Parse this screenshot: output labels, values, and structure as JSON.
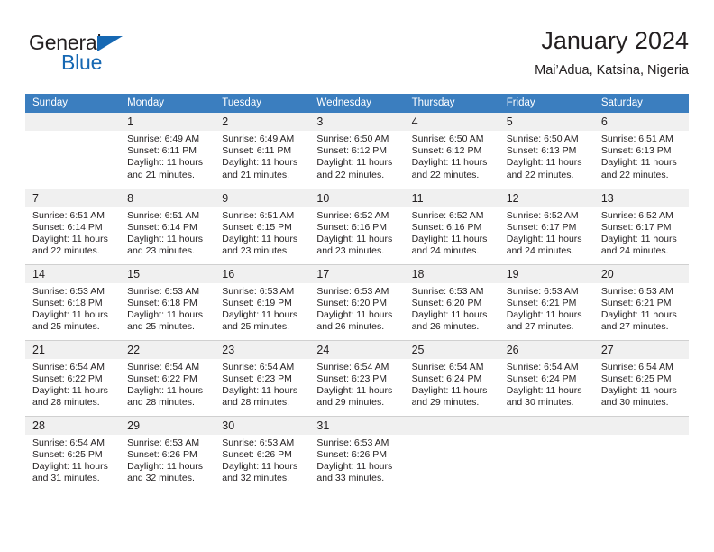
{
  "brand": {
    "word1": "General",
    "word2": "Blue",
    "triangle_color": "#1668b3"
  },
  "header": {
    "title": "January 2024",
    "subtitle": "Mai’Adua, Katsina, Nigeria"
  },
  "theme": {
    "header_bg": "#3b7ebf",
    "daynum_bg": "#f0f0f0",
    "grid_line": "#d0d0d0",
    "text": "#231f20"
  },
  "weekday_headers": [
    "Sunday",
    "Monday",
    "Tuesday",
    "Wednesday",
    "Thursday",
    "Friday",
    "Saturday"
  ],
  "weeks": [
    [
      {
        "day": "",
        "sunrise": "",
        "sunset": "",
        "daylight1": "",
        "daylight2": ""
      },
      {
        "day": "1",
        "sunrise": "Sunrise: 6:49 AM",
        "sunset": "Sunset: 6:11 PM",
        "daylight1": "Daylight: 11 hours",
        "daylight2": "and 21 minutes."
      },
      {
        "day": "2",
        "sunrise": "Sunrise: 6:49 AM",
        "sunset": "Sunset: 6:11 PM",
        "daylight1": "Daylight: 11 hours",
        "daylight2": "and 21 minutes."
      },
      {
        "day": "3",
        "sunrise": "Sunrise: 6:50 AM",
        "sunset": "Sunset: 6:12 PM",
        "daylight1": "Daylight: 11 hours",
        "daylight2": "and 22 minutes."
      },
      {
        "day": "4",
        "sunrise": "Sunrise: 6:50 AM",
        "sunset": "Sunset: 6:12 PM",
        "daylight1": "Daylight: 11 hours",
        "daylight2": "and 22 minutes."
      },
      {
        "day": "5",
        "sunrise": "Sunrise: 6:50 AM",
        "sunset": "Sunset: 6:13 PM",
        "daylight1": "Daylight: 11 hours",
        "daylight2": "and 22 minutes."
      },
      {
        "day": "6",
        "sunrise": "Sunrise: 6:51 AM",
        "sunset": "Sunset: 6:13 PM",
        "daylight1": "Daylight: 11 hours",
        "daylight2": "and 22 minutes."
      }
    ],
    [
      {
        "day": "7",
        "sunrise": "Sunrise: 6:51 AM",
        "sunset": "Sunset: 6:14 PM",
        "daylight1": "Daylight: 11 hours",
        "daylight2": "and 22 minutes."
      },
      {
        "day": "8",
        "sunrise": "Sunrise: 6:51 AM",
        "sunset": "Sunset: 6:14 PM",
        "daylight1": "Daylight: 11 hours",
        "daylight2": "and 23 minutes."
      },
      {
        "day": "9",
        "sunrise": "Sunrise: 6:51 AM",
        "sunset": "Sunset: 6:15 PM",
        "daylight1": "Daylight: 11 hours",
        "daylight2": "and 23 minutes."
      },
      {
        "day": "10",
        "sunrise": "Sunrise: 6:52 AM",
        "sunset": "Sunset: 6:16 PM",
        "daylight1": "Daylight: 11 hours",
        "daylight2": "and 23 minutes."
      },
      {
        "day": "11",
        "sunrise": "Sunrise: 6:52 AM",
        "sunset": "Sunset: 6:16 PM",
        "daylight1": "Daylight: 11 hours",
        "daylight2": "and 24 minutes."
      },
      {
        "day": "12",
        "sunrise": "Sunrise: 6:52 AM",
        "sunset": "Sunset: 6:17 PM",
        "daylight1": "Daylight: 11 hours",
        "daylight2": "and 24 minutes."
      },
      {
        "day": "13",
        "sunrise": "Sunrise: 6:52 AM",
        "sunset": "Sunset: 6:17 PM",
        "daylight1": "Daylight: 11 hours",
        "daylight2": "and 24 minutes."
      }
    ],
    [
      {
        "day": "14",
        "sunrise": "Sunrise: 6:53 AM",
        "sunset": "Sunset: 6:18 PM",
        "daylight1": "Daylight: 11 hours",
        "daylight2": "and 25 minutes."
      },
      {
        "day": "15",
        "sunrise": "Sunrise: 6:53 AM",
        "sunset": "Sunset: 6:18 PM",
        "daylight1": "Daylight: 11 hours",
        "daylight2": "and 25 minutes."
      },
      {
        "day": "16",
        "sunrise": "Sunrise: 6:53 AM",
        "sunset": "Sunset: 6:19 PM",
        "daylight1": "Daylight: 11 hours",
        "daylight2": "and 25 minutes."
      },
      {
        "day": "17",
        "sunrise": "Sunrise: 6:53 AM",
        "sunset": "Sunset: 6:20 PM",
        "daylight1": "Daylight: 11 hours",
        "daylight2": "and 26 minutes."
      },
      {
        "day": "18",
        "sunrise": "Sunrise: 6:53 AM",
        "sunset": "Sunset: 6:20 PM",
        "daylight1": "Daylight: 11 hours",
        "daylight2": "and 26 minutes."
      },
      {
        "day": "19",
        "sunrise": "Sunrise: 6:53 AM",
        "sunset": "Sunset: 6:21 PM",
        "daylight1": "Daylight: 11 hours",
        "daylight2": "and 27 minutes."
      },
      {
        "day": "20",
        "sunrise": "Sunrise: 6:53 AM",
        "sunset": "Sunset: 6:21 PM",
        "daylight1": "Daylight: 11 hours",
        "daylight2": "and 27 minutes."
      }
    ],
    [
      {
        "day": "21",
        "sunrise": "Sunrise: 6:54 AM",
        "sunset": "Sunset: 6:22 PM",
        "daylight1": "Daylight: 11 hours",
        "daylight2": "and 28 minutes."
      },
      {
        "day": "22",
        "sunrise": "Sunrise: 6:54 AM",
        "sunset": "Sunset: 6:22 PM",
        "daylight1": "Daylight: 11 hours",
        "daylight2": "and 28 minutes."
      },
      {
        "day": "23",
        "sunrise": "Sunrise: 6:54 AM",
        "sunset": "Sunset: 6:23 PM",
        "daylight1": "Daylight: 11 hours",
        "daylight2": "and 28 minutes."
      },
      {
        "day": "24",
        "sunrise": "Sunrise: 6:54 AM",
        "sunset": "Sunset: 6:23 PM",
        "daylight1": "Daylight: 11 hours",
        "daylight2": "and 29 minutes."
      },
      {
        "day": "25",
        "sunrise": "Sunrise: 6:54 AM",
        "sunset": "Sunset: 6:24 PM",
        "daylight1": "Daylight: 11 hours",
        "daylight2": "and 29 minutes."
      },
      {
        "day": "26",
        "sunrise": "Sunrise: 6:54 AM",
        "sunset": "Sunset: 6:24 PM",
        "daylight1": "Daylight: 11 hours",
        "daylight2": "and 30 minutes."
      },
      {
        "day": "27",
        "sunrise": "Sunrise: 6:54 AM",
        "sunset": "Sunset: 6:25 PM",
        "daylight1": "Daylight: 11 hours",
        "daylight2": "and 30 minutes."
      }
    ],
    [
      {
        "day": "28",
        "sunrise": "Sunrise: 6:54 AM",
        "sunset": "Sunset: 6:25 PM",
        "daylight1": "Daylight: 11 hours",
        "daylight2": "and 31 minutes."
      },
      {
        "day": "29",
        "sunrise": "Sunrise: 6:53 AM",
        "sunset": "Sunset: 6:26 PM",
        "daylight1": "Daylight: 11 hours",
        "daylight2": "and 32 minutes."
      },
      {
        "day": "30",
        "sunrise": "Sunrise: 6:53 AM",
        "sunset": "Sunset: 6:26 PM",
        "daylight1": "Daylight: 11 hours",
        "daylight2": "and 32 minutes."
      },
      {
        "day": "31",
        "sunrise": "Sunrise: 6:53 AM",
        "sunset": "Sunset: 6:26 PM",
        "daylight1": "Daylight: 11 hours",
        "daylight2": "and 33 minutes."
      },
      {
        "day": "",
        "sunrise": "",
        "sunset": "",
        "daylight1": "",
        "daylight2": ""
      },
      {
        "day": "",
        "sunrise": "",
        "sunset": "",
        "daylight1": "",
        "daylight2": ""
      },
      {
        "day": "",
        "sunrise": "",
        "sunset": "",
        "daylight1": "",
        "daylight2": ""
      }
    ]
  ]
}
